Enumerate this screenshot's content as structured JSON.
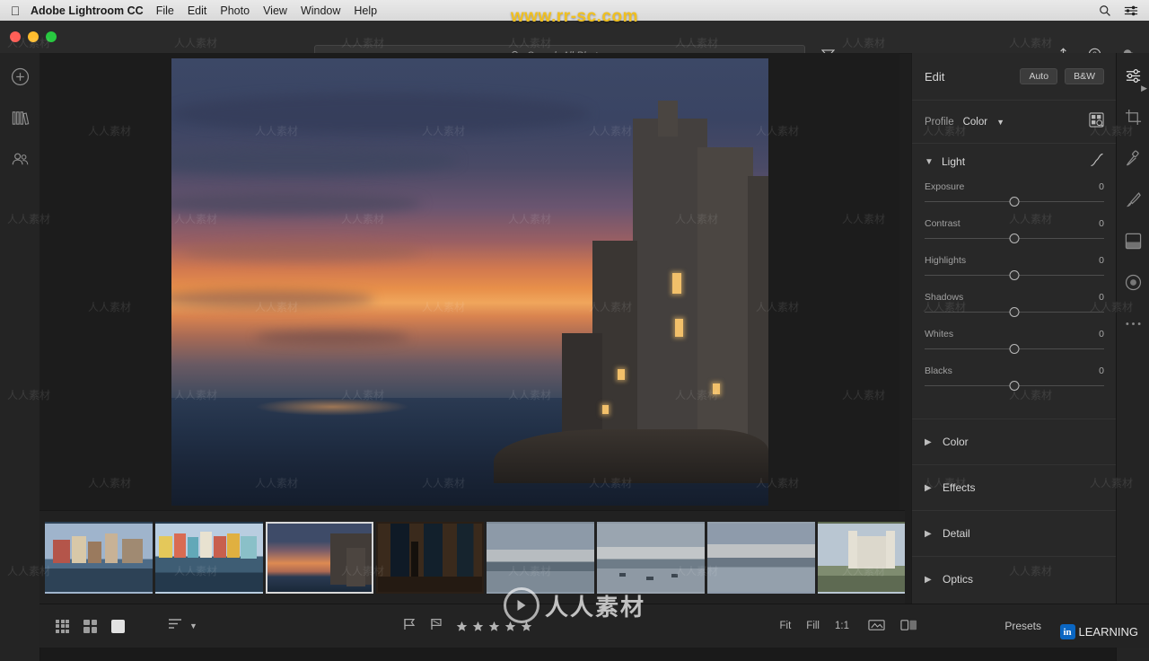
{
  "menubar": {
    "apple_icon": "apple-logo-icon",
    "app_name": "Adobe Lightroom CC",
    "items": [
      "File",
      "Edit",
      "Photo",
      "View",
      "Window",
      "Help"
    ],
    "right_icons": [
      "search-icon",
      "control-center-icon"
    ]
  },
  "watermark": {
    "url": "www.rr-sc.com",
    "tile_text": "人人素材",
    "center_text": "人人素材",
    "linkedin_text": "LEARNING",
    "linkedin_badge": "in"
  },
  "titlebar": {
    "traffic_lights": [
      "close",
      "minimize",
      "zoom"
    ],
    "search_placeholder": "Search All Photos",
    "search_value": "",
    "search_icon": "magnifier-icon",
    "filter_icon": "funnel-icon",
    "right_icons": [
      "share-icon",
      "help-icon",
      "cloud-icon"
    ]
  },
  "left_rail": {
    "items": [
      {
        "name": "add-photos-icon",
        "label": "Add Photos"
      },
      {
        "name": "library-icon",
        "label": "My Photos"
      },
      {
        "name": "shared-icon",
        "label": "Shared With Me"
      }
    ]
  },
  "right_rail": {
    "items": [
      {
        "name": "edit-sliders-icon",
        "label": "Edit",
        "active": true
      },
      {
        "name": "crop-icon",
        "label": "Crop & Rotate",
        "active": false
      },
      {
        "name": "healing-brush-icon",
        "label": "Healing Brush",
        "active": false
      },
      {
        "name": "brush-icon",
        "label": "Brush",
        "active": false
      },
      {
        "name": "linear-gradient-icon",
        "label": "Linear Gradient",
        "active": false
      },
      {
        "name": "radial-gradient-icon",
        "label": "Radial Gradient",
        "active": false
      },
      {
        "name": "more-options-icon",
        "label": "More",
        "active": false
      }
    ]
  },
  "edit_panel": {
    "title": "Edit",
    "auto_label": "Auto",
    "bw_label": "B&W",
    "profile": {
      "label": "Profile",
      "value": "Color",
      "chevron": "chevron-down-icon",
      "browse_icon": "profile-browser-icon"
    },
    "light": {
      "name": "Light",
      "expanded": true,
      "curve_icon": "tone-curve-icon",
      "sliders": [
        {
          "name": "Exposure",
          "value": "0",
          "pos": 50
        },
        {
          "name": "Contrast",
          "value": "0",
          "pos": 50
        },
        {
          "name": "Highlights",
          "value": "0",
          "pos": 50
        },
        {
          "name": "Shadows",
          "value": "0",
          "pos": 50
        },
        {
          "name": "Whites",
          "value": "0",
          "pos": 50
        },
        {
          "name": "Blacks",
          "value": "0",
          "pos": 50
        }
      ]
    },
    "collapsed_sections": [
      {
        "name": "Color"
      },
      {
        "name": "Effects"
      },
      {
        "name": "Detail"
      },
      {
        "name": "Optics"
      }
    ]
  },
  "filmstrip": {
    "thumbnails": [
      {
        "id": "thumb-1",
        "label": "Burano canal houses",
        "selected": false
      },
      {
        "id": "thumb-2",
        "label": "Colorful houses waterfront",
        "selected": false
      },
      {
        "id": "thumb-3",
        "label": "Coastal sunset town",
        "selected": true
      },
      {
        "id": "thumb-4",
        "label": "Statue through arches",
        "selected": false
      },
      {
        "id": "thumb-5",
        "label": "Lake at dusk",
        "selected": false
      },
      {
        "id": "thumb-6",
        "label": "Lake with boats",
        "selected": false
      },
      {
        "id": "thumb-7",
        "label": "Lake panorama sunset",
        "selected": false
      },
      {
        "id": "thumb-8",
        "label": "Baroque church",
        "selected": false
      }
    ]
  },
  "bottom_bar": {
    "left_icons": [
      "grid-view-icon",
      "square-grid-icon",
      "single-photo-icon",
      "sort-icon",
      "chevron-down-icon"
    ],
    "center_icons": [
      "flag-icon",
      "reject-flag-icon",
      "star-rating-icon"
    ],
    "zoom_options": [
      "Fit",
      "Fill",
      "1:1"
    ],
    "right_icons": [
      "compare-icon",
      "before-after-icon"
    ],
    "presets_label": "Presets"
  }
}
